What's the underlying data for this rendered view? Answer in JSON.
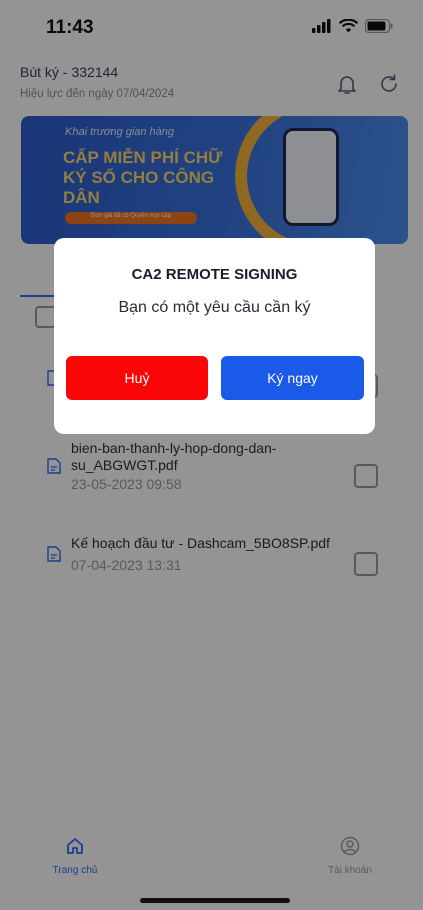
{
  "status_bar": {
    "time": "11:43",
    "icons": [
      "cellular-signal-icon",
      "wifi-icon",
      "battery-icon"
    ]
  },
  "header": {
    "signer_label": "Bút ký -",
    "signer_id": "332144",
    "validity": "Hiệu lực đến ngày 07/04/2024",
    "icons": [
      "bell-icon",
      "refresh-icon"
    ]
  },
  "banner": {
    "line1": "Khai trương gian hàng",
    "headline": "CẤP MIỄN PHÍ CHỮ KÝ SỐ CHO CÔNG DÂN",
    "button_text": "Đơn giá đã có Quyền truy cập"
  },
  "documents": [
    {
      "name": "bien-ban-thanh-ly-hop-dong-dan-su_ABGWGT.pdf",
      "date": "23-05-2023 09:58"
    },
    {
      "name": "Kế hoạch đầu tư - Dashcam_5BO8SP.pdf",
      "date": "07-04-2023 13:31"
    }
  ],
  "bottom_nav": {
    "home_label": "Trang chủ",
    "account_label": "Tài khoản"
  },
  "modal": {
    "title": "CA2 REMOTE SIGNING",
    "message": "Bạn có một yêu cầu cần ký",
    "cancel_label": "Huỷ",
    "sign_label": "Ký ngay"
  },
  "colors": {
    "cancel": "#fb0606",
    "primary": "#1b5ae8",
    "accent": "#2b6ef2",
    "overlay": "rgba(0,0,0,0.42)"
  }
}
